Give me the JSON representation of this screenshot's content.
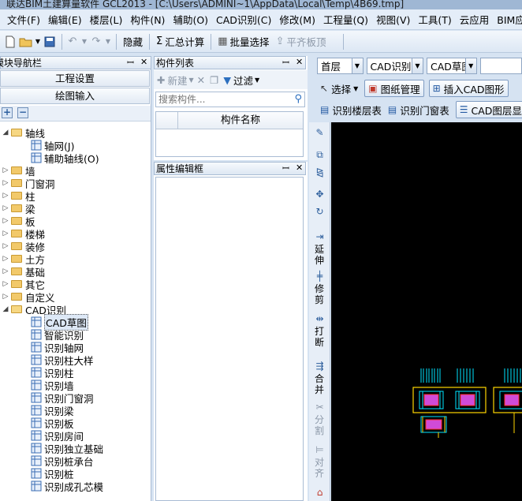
{
  "window": {
    "title": "联达BIM土建算量软件 GCL2013 - [C:\\Users\\ADMINI~1\\AppData\\Local\\Temp\\4B69.tmp]"
  },
  "menu": [
    "文件(F)",
    "编辑(E)",
    "楼层(L)",
    "构件(N)",
    "辅助(O)",
    "CAD识别(C)",
    "修改(M)",
    "工程量(Q)",
    "视图(V)",
    "工具(T)",
    "云应用",
    "BIM应用(I)"
  ],
  "toolbar": {
    "hide": "隐藏",
    "sum_calc": "汇总计算",
    "batch_select": "批量选择",
    "flat_board_top": "平齐板顶"
  },
  "nav": {
    "title": "模块导航栏",
    "project_settings": "工程设置",
    "drawing_input": "绘图输入",
    "tree": [
      {
        "label": "轴线",
        "level": 0,
        "expanded": true
      },
      {
        "label": "轴网(J)",
        "level": 1
      },
      {
        "label": "辅助轴线(O)",
        "level": 1
      },
      {
        "label": "墙",
        "level": 0
      },
      {
        "label": "门窗洞",
        "level": 0
      },
      {
        "label": "柱",
        "level": 0
      },
      {
        "label": "梁",
        "level": 0
      },
      {
        "label": "板",
        "level": 0
      },
      {
        "label": "楼梯",
        "level": 0
      },
      {
        "label": "装修",
        "level": 0
      },
      {
        "label": "土方",
        "level": 0
      },
      {
        "label": "基础",
        "level": 0
      },
      {
        "label": "其它",
        "level": 0
      },
      {
        "label": "自定义",
        "level": 0
      },
      {
        "label": "CAD识别",
        "level": 0,
        "expanded": true
      },
      {
        "label": "CAD草图",
        "level": 1,
        "selected": true
      },
      {
        "label": "智能识别",
        "level": 1
      },
      {
        "label": "识别轴网",
        "level": 1
      },
      {
        "label": "识别柱大样",
        "level": 1
      },
      {
        "label": "识别柱",
        "level": 1
      },
      {
        "label": "识别墙",
        "level": 1
      },
      {
        "label": "识别门窗洞",
        "level": 1
      },
      {
        "label": "识别梁",
        "level": 1
      },
      {
        "label": "识别板",
        "level": 1
      },
      {
        "label": "识别房间",
        "level": 1
      },
      {
        "label": "识别独立基础",
        "level": 1
      },
      {
        "label": "识别桩承台",
        "level": 1
      },
      {
        "label": "识别桩",
        "level": 1
      },
      {
        "label": "识别成孔芯模",
        "level": 1
      }
    ]
  },
  "components": {
    "title": "构件列表",
    "new_label": "新建",
    "filter_label": "过滤",
    "search_placeholder": "搜索构件...",
    "column_name": "构件名称"
  },
  "properties": {
    "title": "属性编辑框"
  },
  "right": {
    "floor_value": "首层",
    "cad_recognize": "CAD识别",
    "cad_sketch": "CAD草图",
    "select_label": "选择",
    "drawing_manage": "图纸管理",
    "insert_cad": "插入CAD图形",
    "floor_table": "识别楼层表",
    "door_window_table": "识别门窗表",
    "cad_layer": "CAD图层显"
  },
  "vtools": {
    "extend": "延伸",
    "trim": "修剪",
    "break": "打断",
    "merge": "合并",
    "split": "分割",
    "align": "对齐"
  },
  "colors": {
    "canvas": "#000000",
    "cad_cyan": "#00e5ff",
    "cad_yellow": "#ffd600",
    "cad_red": "#ff2b2b",
    "cad_magenta": "#d04bd8"
  }
}
